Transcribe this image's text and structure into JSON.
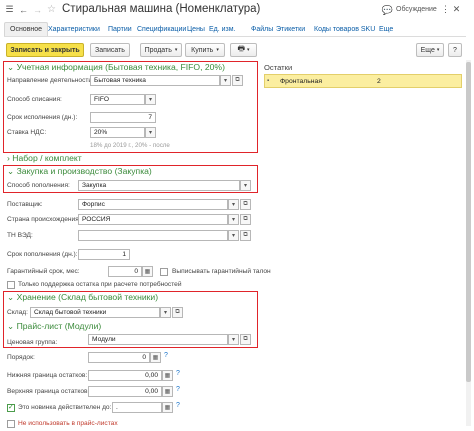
{
  "window": {
    "title": "Стиральная машина (Номенклатура)",
    "discussion_label": "Обсуждение"
  },
  "tabs": [
    "Основное",
    "Характеристики",
    "Партии",
    "Спецификации",
    "Цены",
    "Ед. изм.",
    "Файлы",
    "Этикетки",
    "Коды товаров SKU",
    "Еще"
  ],
  "toolbar": {
    "save_close": "Записать и закрыть",
    "save": "Записать",
    "sell": "Продать",
    "buy": "Купить",
    "more": "Еще",
    "help": "?"
  },
  "accounting": {
    "title": "Учетная информация (Бытовая техника, FIFO, 20%)",
    "direction_label": "Направление деятельности:",
    "direction_value": "Бытовая техника",
    "writeoff_label": "Способ списания:",
    "writeoff_value": "FIFO",
    "term_label": "Срок исполнения (дн.):",
    "term_value": "7",
    "vat_label": "Ставка НДС:",
    "vat_value": "20%",
    "vat_hint": "18% до 2019 г., 20% - после"
  },
  "kit": {
    "title": "Набор / комплект"
  },
  "purchase": {
    "title": "Закупка и производство (Закупка)",
    "replenish_label": "Способ пополнения:",
    "replenish_value": "Закупка",
    "supplier_label": "Поставщик:",
    "supplier_value": "Форпис",
    "country_label": "Страна происхождения:",
    "country_value": "РОССИЯ",
    "tnved_label": "ТН ВЭД:",
    "tnved_value": "",
    "replenish_term_label": "Срок пополнения (дн.):",
    "replenish_term_value": "1",
    "warranty_label": "Гарантийный срок, мес:",
    "warranty_value": "0",
    "warranty_coupon": "Выписывать гарантийный талон",
    "only_balance": "Только поддержка остатка при расчете потребностей"
  },
  "storage": {
    "title": "Хранение (Склад бытовой техники)",
    "warehouse_label": "Склад:",
    "warehouse_value": "Склад бытовой техники"
  },
  "pricelist": {
    "title": "Прайс-лист (Модули)",
    "group_label": "Ценовая группа:",
    "group_value": "Модули",
    "order_label": "Порядок:",
    "order_value": "0",
    "lower_label": "Нижняя граница остатков:",
    "lower_value": "0,00",
    "upper_label": "Верхняя граница остатков:",
    "upper_value": "0,00",
    "new_label": "Это новинка",
    "valid_label": "действителен до:",
    "valid_value": ".",
    "exclude_label": "Не использовать в прайс-листах"
  },
  "stock_panel": {
    "title": "Остатки",
    "rows": [
      {
        "name": "Фронтальная",
        "qty": "2"
      }
    ]
  },
  "colors": {
    "accent_red": "#e0242a",
    "section_green": "#3a8a3a",
    "link_blue": "#0b5ea8",
    "primary_yellow": "#f6e049",
    "selected_row": "#fbeea0"
  }
}
